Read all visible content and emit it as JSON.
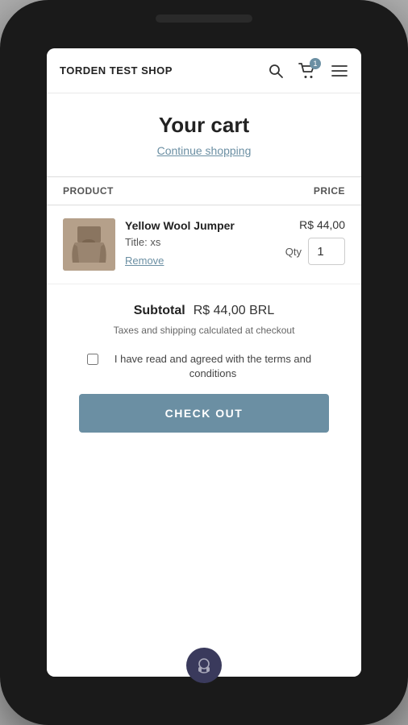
{
  "brand": {
    "name": "TORDEN TEST SHOP"
  },
  "nav": {
    "search_label": "Search",
    "cart_label": "Cart",
    "menu_label": "Menu",
    "cart_badge_count": "1"
  },
  "cart": {
    "title": "Your cart",
    "continue_shopping": "Continue shopping",
    "table": {
      "product_header": "PRODUCT",
      "price_header": "PRICE"
    },
    "items": [
      {
        "name": "Yellow Wool Jumper",
        "variant_label": "Title:",
        "variant_value": "xs",
        "price": "R$ 44,00",
        "qty": "1",
        "remove_label": "Remove"
      }
    ],
    "subtotal": {
      "label": "Subtotal",
      "value": "R$ 44,00 BRL"
    },
    "tax_note": "Taxes and shipping calculated at checkout",
    "terms_text": "I have read and agreed with the terms and conditions",
    "checkout_label": "CHECK OUT"
  }
}
